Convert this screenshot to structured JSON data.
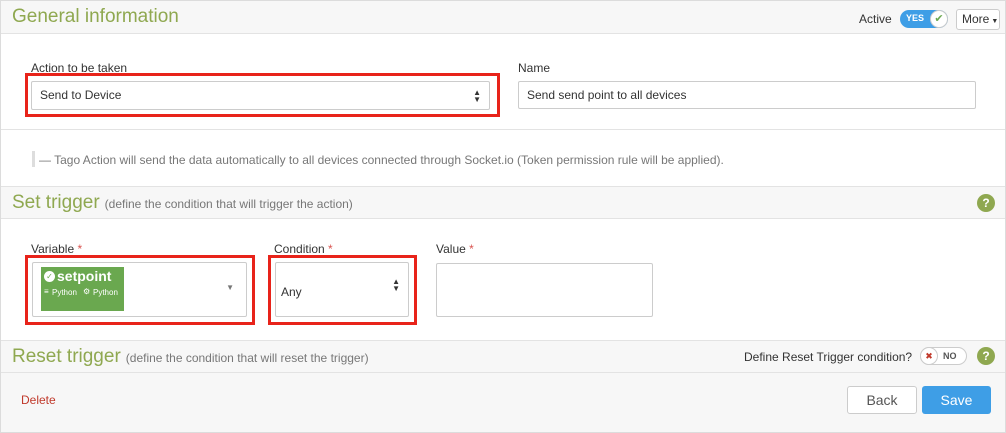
{
  "general": {
    "title": "General information",
    "active_label": "Active",
    "active_toggle": "YES",
    "more_label": "More"
  },
  "action": {
    "label": "Action to be taken",
    "value": "Send to Device",
    "name_label": "Name",
    "name_value": "Send send point to all devices",
    "note": "— Tago Action will send the data automatically to all devices connected through Socket.io (Token permission rule will be applied)."
  },
  "trigger": {
    "title": "Set trigger",
    "subtitle": "(define the condition that will trigger the action)",
    "help": "?",
    "variable_label": "Variable",
    "condition_label": "Condition",
    "value_label": "Value",
    "required_mark": "*",
    "variable_chip": {
      "name": "setpoint",
      "bucket": "Python",
      "device": "Python"
    },
    "condition_value": "Any"
  },
  "reset": {
    "title": "Reset trigger",
    "subtitle": "(define the condition that will reset the trigger)",
    "define_label": "Define Reset Trigger condition?",
    "toggle": "NO",
    "help": "?"
  },
  "footer": {
    "delete_label": "Delete",
    "back_label": "Back",
    "save_label": "Save"
  },
  "colors": {
    "accent_green": "#8fa850",
    "primary_blue": "#3e9ee6",
    "highlight_red": "#e8231a",
    "chip_green": "#6aa84f"
  }
}
